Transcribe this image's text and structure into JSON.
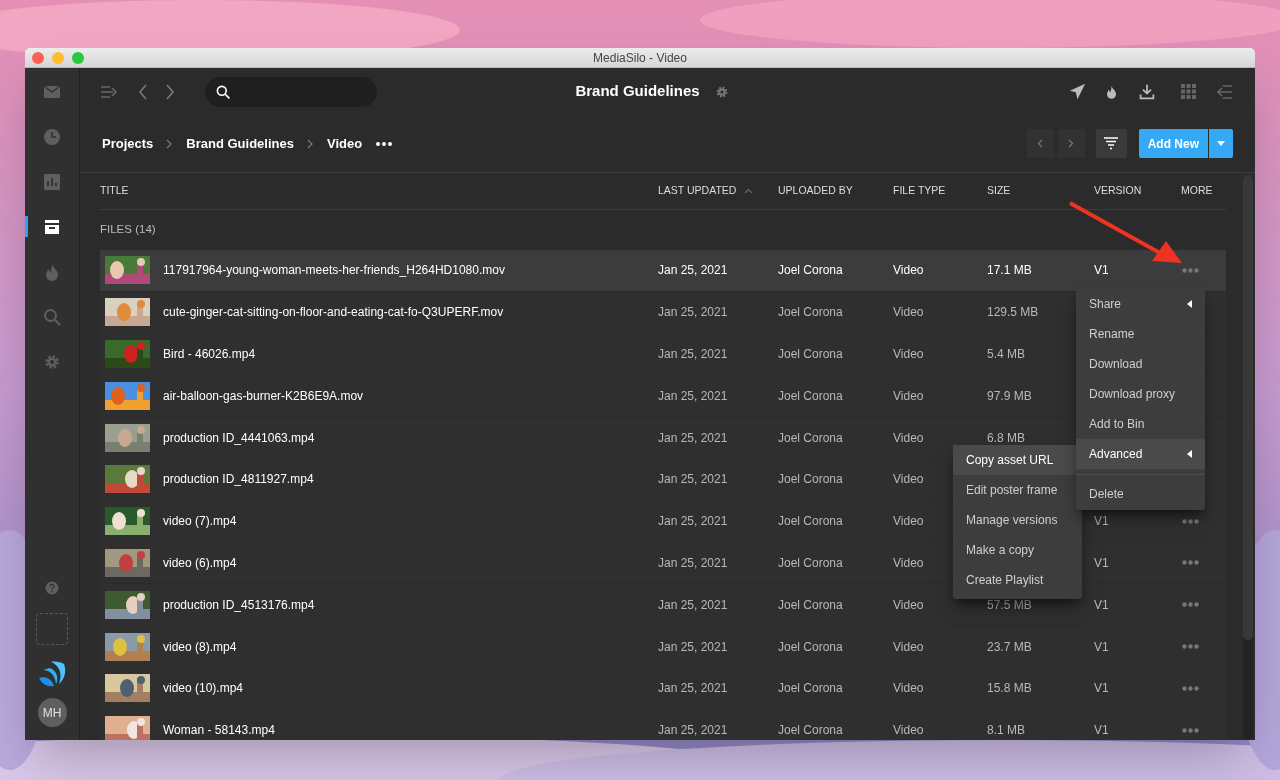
{
  "window": {
    "title": "MediaSilo - Video"
  },
  "sidebar": {
    "items": [
      {
        "kind": "mail",
        "selected": false
      },
      {
        "kind": "clock",
        "selected": false
      },
      {
        "kind": "chart",
        "selected": false
      },
      {
        "kind": "archive",
        "selected": true
      },
      {
        "kind": "flame",
        "selected": false
      },
      {
        "kind": "search",
        "selected": false
      },
      {
        "kind": "gear",
        "selected": false
      }
    ],
    "bottom_items": [
      {
        "kind": "help"
      },
      {
        "kind": "placeholder"
      },
      {
        "kind": "logo"
      }
    ],
    "avatar": "MH"
  },
  "toolbar": {
    "title": "Brand Guidelines"
  },
  "breadcrumb": [
    "Projects",
    "Brand Guidelines",
    "Video"
  ],
  "add_button": "Add New",
  "table": {
    "columns": [
      {
        "label": "TITLE",
        "sorted": false
      },
      {
        "label": "LAST UPDATED",
        "sorted": true
      },
      {
        "label": "UPLOADED BY",
        "sorted": false
      },
      {
        "label": "FILE TYPE",
        "sorted": false
      },
      {
        "label": "SIZE",
        "sorted": false
      },
      {
        "label": "VERSION",
        "sorted": false
      },
      {
        "label": "MORE",
        "sorted": false
      }
    ],
    "section": "FILES (14)",
    "rows": [
      {
        "name": "117917964-young-woman-meets-her-friends_H264HD1080.mov",
        "updated": "Jan 25, 2021",
        "uploaded_by": "Joel Corona",
        "type": "Video",
        "size": "17.1 MB",
        "version": "V1",
        "selected": true
      },
      {
        "name": "cute-ginger-cat-sitting-on-floor-and-eating-cat-fo-Q3UPERF.mov",
        "updated": "Jan 25, 2021",
        "uploaded_by": "Joel Corona",
        "type": "Video",
        "size": "129.5 MB",
        "selected": false
      },
      {
        "name": "Bird - 46026.mp4",
        "updated": "Jan 25, 2021",
        "uploaded_by": "Joel Corona",
        "type": "Video",
        "size": "5.4 MB",
        "selected": false
      },
      {
        "name": "air-balloon-gas-burner-K2B6E9A.mov",
        "updated": "Jan 25, 2021",
        "uploaded_by": "Joel Corona",
        "type": "Video",
        "size": "97.9 MB",
        "selected": false
      },
      {
        "name": "production ID_4441063.mp4",
        "updated": "Jan 25, 2021",
        "uploaded_by": "Joel Corona",
        "type": "Video",
        "size": "6.8 MB",
        "selected": false
      },
      {
        "name": "production ID_4811927.mp4",
        "updated": "Jan 25, 2021",
        "uploaded_by": "Joel Corona",
        "type": "Video",
        "selected": false
      },
      {
        "name": "video (7).mp4",
        "updated": "Jan 25, 2021",
        "uploaded_by": "Joel Corona",
        "type": "Video",
        "version": "V1",
        "selected": false
      },
      {
        "name": "video (6).mp4",
        "updated": "Jan 25, 2021",
        "uploaded_by": "Joel Corona",
        "type": "Video",
        "version": "V1",
        "selected": false
      },
      {
        "name": "production ID_4513176.mp4",
        "updated": "Jan 25, 2021",
        "uploaded_by": "Joel Corona",
        "type": "Video",
        "size": "57.5 MB",
        "version": "V1",
        "selected": false
      },
      {
        "name": "video (8).mp4",
        "updated": "Jan 25, 2021",
        "uploaded_by": "Joel Corona",
        "type": "Video",
        "size": "23.7 MB",
        "version": "V1",
        "selected": false
      },
      {
        "name": "video (10).mp4",
        "updated": "Jan 25, 2021",
        "uploaded_by": "Joel Corona",
        "type": "Video",
        "size": "15.8 MB",
        "version": "V1",
        "selected": false
      },
      {
        "name": "Woman - 58143.mp4",
        "updated": "Jan 25, 2021",
        "uploaded_by": "Joel Corona",
        "type": "Video",
        "size": "8.1 MB",
        "version": "V1",
        "selected": false
      }
    ]
  },
  "context_menu": {
    "items": [
      {
        "label": "Share",
        "submenu": true,
        "highlighted": false,
        "separator": false
      },
      {
        "label": "Rename",
        "submenu": false,
        "highlighted": false,
        "separator": false
      },
      {
        "label": "Download",
        "submenu": false,
        "highlighted": false,
        "separator": false
      },
      {
        "label": "Download proxy",
        "submenu": false,
        "highlighted": false,
        "separator": false
      },
      {
        "label": "Add to Bin",
        "submenu": false,
        "highlighted": false,
        "separator": false
      },
      {
        "label": "Advanced",
        "submenu": true,
        "highlighted": true,
        "separator": false
      },
      {
        "label": "Delete",
        "submenu": false,
        "highlighted": false,
        "separator": true
      }
    ]
  },
  "submenu": {
    "items": [
      {
        "label": "Copy asset URL",
        "highlighted": true
      },
      {
        "label": "Edit poster frame",
        "highlighted": false
      },
      {
        "label": "Manage versions",
        "highlighted": false
      },
      {
        "label": "Make a copy",
        "highlighted": false
      },
      {
        "label": "Create Playlist",
        "highlighted": false
      }
    ]
  }
}
